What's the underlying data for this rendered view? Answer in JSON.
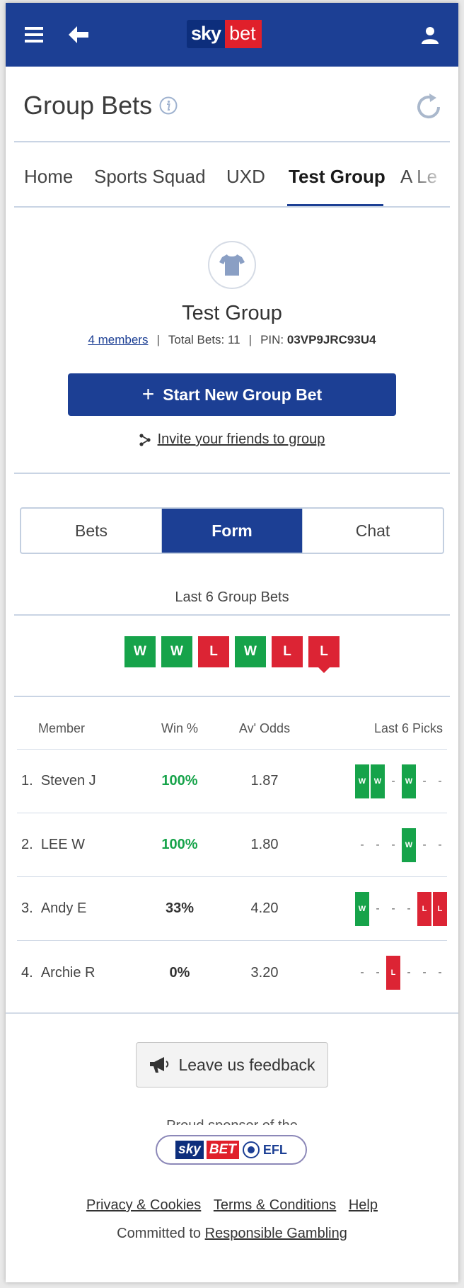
{
  "header": {
    "brand_sky": "sky",
    "brand_bet": "bet"
  },
  "page": {
    "title": "Group Bets"
  },
  "group_tabs": [
    {
      "label": "Home"
    },
    {
      "label": "Sports Squad"
    },
    {
      "label": "UXD"
    },
    {
      "label": "Test Group"
    },
    {
      "label": "A Le"
    }
  ],
  "group": {
    "name": "Test Group",
    "members_link": "4 members",
    "total_bets": "Total Bets: 11",
    "pin_label": "PIN:",
    "pin_value": "03VP9JRC93U4",
    "start_button": "Start New Group Bet",
    "invite_link": "Invite your friends to group"
  },
  "view_tabs": [
    {
      "label": "Bets"
    },
    {
      "label": "Form"
    },
    {
      "label": "Chat"
    }
  ],
  "form": {
    "last6_title": "Last 6 Group Bets",
    "results": [
      "W",
      "W",
      "L",
      "W",
      "L",
      "L"
    ],
    "columns": {
      "member": "Member",
      "win": "Win %",
      "odds": "Av' Odds",
      "picks": "Last 6 Picks"
    },
    "rows": [
      {
        "rank": "1.",
        "name": "Steven J",
        "win": "100%",
        "odds": "1.87",
        "picks": [
          "W",
          "W",
          "-",
          "W",
          "-",
          "-"
        ]
      },
      {
        "rank": "2.",
        "name": "LEE W",
        "win": "100%",
        "odds": "1.80",
        "picks": [
          "-",
          "-",
          "-",
          "W",
          "-",
          "-"
        ]
      },
      {
        "rank": "3.",
        "name": "Andy E",
        "win": "33%",
        "odds": "4.20",
        "picks": [
          "W",
          "-",
          "-",
          "-",
          "L",
          "L"
        ]
      },
      {
        "rank": "4.",
        "name": "Archie R",
        "win": "0%",
        "odds": "3.20",
        "picks": [
          "-",
          "-",
          "L",
          "-",
          "-",
          "-"
        ]
      }
    ]
  },
  "footer": {
    "feedback_button": "Leave us feedback",
    "partner_text": "Proud sponsor of the",
    "badge_sky": "sky",
    "badge_bet": "BET",
    "badge_efl": "EFL",
    "privacy": "Privacy & Cookies",
    "terms": "Terms & Conditions",
    "help": "Help",
    "committed_prefix": "Committed to",
    "responsible": "Responsible Gambling"
  },
  "colors": {
    "brand_blue": "#1c3f94",
    "win_green": "#16a34a",
    "loss_red": "#dc2434"
  }
}
